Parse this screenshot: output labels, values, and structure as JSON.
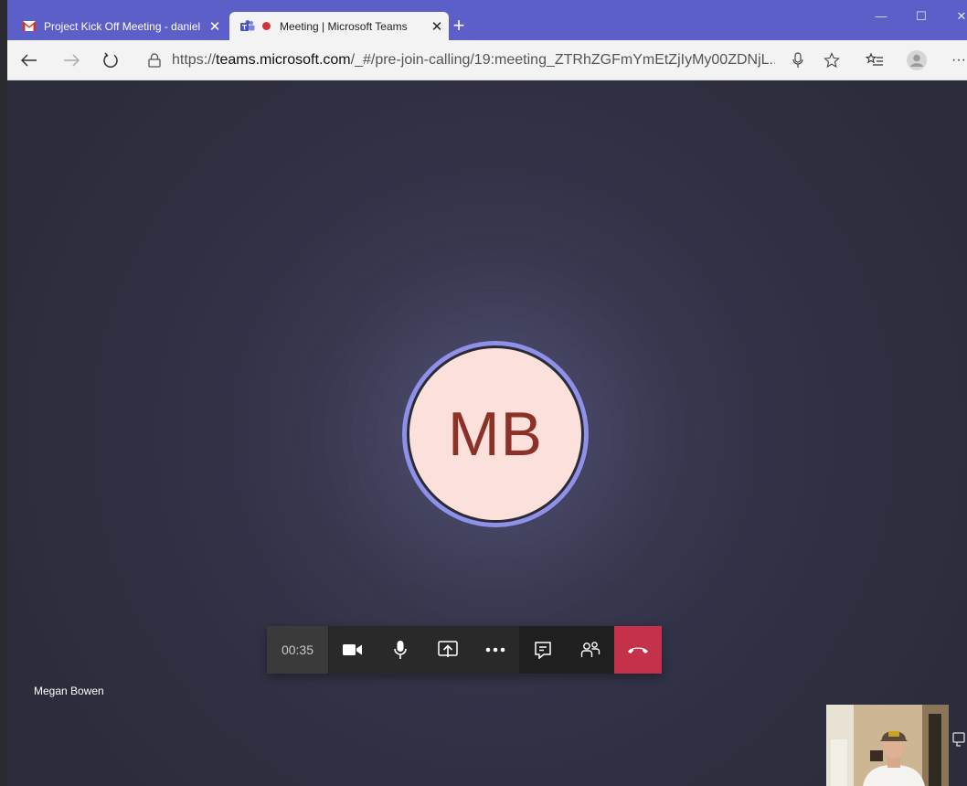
{
  "browser": {
    "tabs": [
      {
        "title": "Project Kick Off Meeting - daniel",
        "icon": "gmail-icon",
        "close": "✕"
      },
      {
        "title": "Meeting | Microsoft Teams",
        "icon": "teams-icon",
        "recording": true,
        "close": "✕"
      }
    ],
    "new_tab": "+",
    "window_controls": {
      "minimize": "—",
      "maximize": "☐",
      "close": "✕"
    },
    "url_prefix": "https://",
    "url_domain": "teams.microsoft.com",
    "url_path": "/_#/pre-join-calling/19:meeting_ZTRhZGFmYmEtZjIyMy00ZDNjL...",
    "more": "···"
  },
  "meeting": {
    "avatar_initials": "MB",
    "timer": "00:35",
    "participant_name": "Megan Bowen"
  },
  "colors": {
    "titlebar": "#5b5fc7",
    "avatar_bg": "#fbe0db",
    "avatar_text": "#8c3127",
    "avatar_ring": "#8f90ea",
    "hangup": "#c4314b"
  }
}
